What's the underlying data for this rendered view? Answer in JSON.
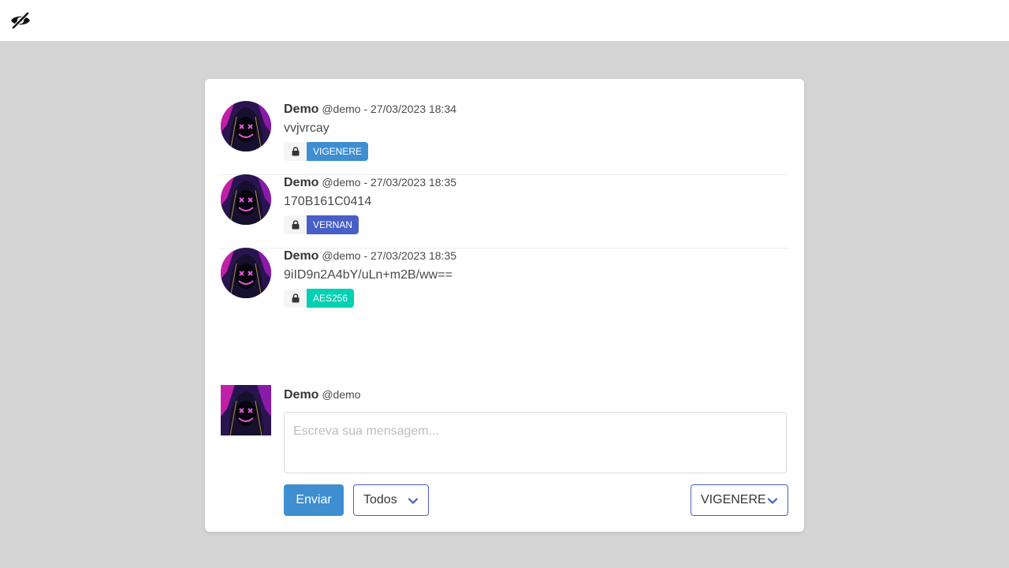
{
  "header": {
    "logo_icon": "eye-slash-icon"
  },
  "posts": [
    {
      "name": "Demo",
      "handle": "@demo",
      "separator": "-",
      "timestamp": "27/03/2023 18:34",
      "message": "vvjvrcay",
      "lock_icon": "lock-icon",
      "algorithm": "VIGENERE",
      "algorithm_color": "#3e8ed0"
    },
    {
      "name": "Demo",
      "handle": "@demo",
      "separator": "-",
      "timestamp": "27/03/2023 18:35",
      "message": "170B161C0414",
      "lock_icon": "lock-icon",
      "algorithm": "VERNAN",
      "algorithm_color": "#485fc7"
    },
    {
      "name": "Demo",
      "handle": "@demo",
      "separator": "-",
      "timestamp": "27/03/2023 18:35",
      "message": "9iID9n2A4bY/uLn+m2B/ww==",
      "lock_icon": "lock-icon",
      "algorithm": "AES256",
      "algorithm_color": "#00d1b2"
    }
  ],
  "composer": {
    "name": "Demo",
    "handle": "@demo",
    "placeholder": "Escreva sua mensagem...",
    "send_label": "Enviar",
    "audience_selected": "Todos",
    "algorithm_selected": "VIGENERE"
  },
  "colors": {
    "primary": "#3e8ed0",
    "link": "#485fc7",
    "page_bg": "#d4d4d4"
  }
}
